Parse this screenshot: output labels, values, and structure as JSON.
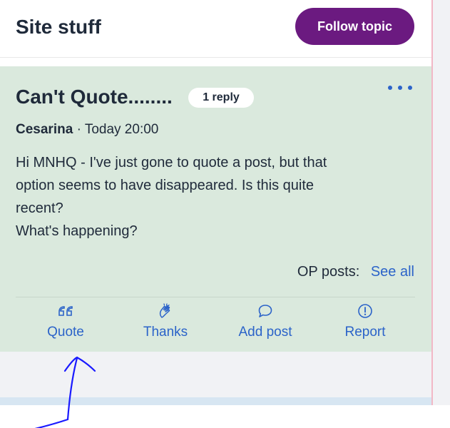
{
  "header": {
    "title": "Site stuff",
    "follow_label": "Follow topic"
  },
  "post": {
    "title": "Can't Quote........",
    "reply_badge": "1 reply",
    "author": "Cesarina",
    "separator": "·",
    "time": "Today 20:00",
    "body_lines": [
      "Hi MNHQ - I've just gone to quote a post, but that",
      "option seems to have disappeared. Is this quite",
      "recent?",
      "What's happening?"
    ],
    "op_posts_label": "OP posts:",
    "see_all_label": "See all",
    "actions": [
      {
        "label": "Quote",
        "icon": "quote-icon"
      },
      {
        "label": "Thanks",
        "icon": "clapping-hands-icon"
      },
      {
        "label": "Add post",
        "icon": "speech-bubble-icon"
      },
      {
        "label": "Report",
        "icon": "alert-circle-icon"
      }
    ]
  },
  "colors": {
    "accent": "#6b1a80",
    "link": "#2b63c9",
    "post_background": "#dae9dd",
    "annotation_ink": "#1a1aff"
  }
}
